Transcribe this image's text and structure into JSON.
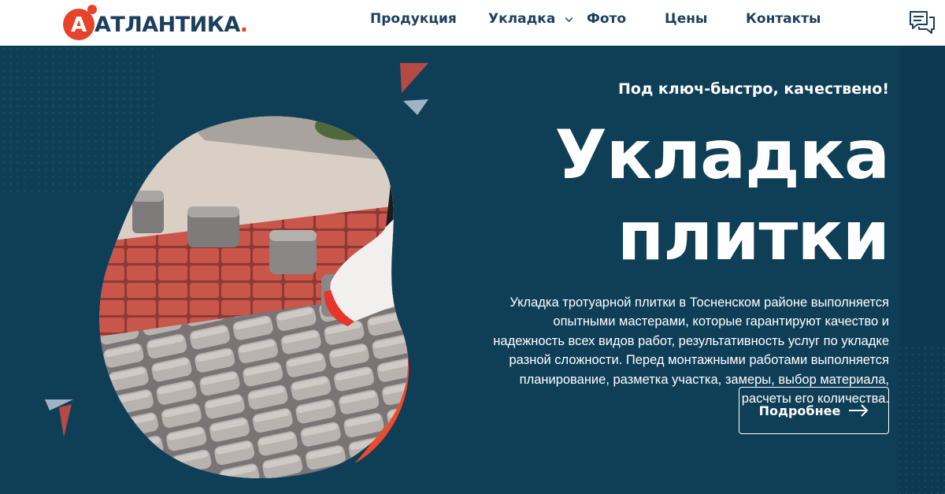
{
  "brand": {
    "mark_letter": "А",
    "name": "АТЛАНТИКА",
    "dot": ".",
    "accent_color": "#e8422b",
    "navy_color": "#1c3f5e"
  },
  "nav": {
    "items": [
      {
        "label": "Продукция",
        "has_dropdown": false
      },
      {
        "label": "Укладка",
        "has_dropdown": true
      },
      {
        "label": "Фото",
        "has_dropdown": false
      },
      {
        "label": "Цены",
        "has_dropdown": false
      },
      {
        "label": "Контакты",
        "has_dropdown": false
      }
    ]
  },
  "chat": {
    "icon": "chat-bubbles-icon"
  },
  "hero": {
    "slogan": "Под ключ-быстро, качествено!",
    "title_line1": "Укладка",
    "title_line2": "плитки",
    "description": "Укладка тротуарной плитки в Тосненском районе выполняется опытными мастерами, которые гарантируют качество и надежность всех видов работ, результативность услуг по укладке разной сложности. Перед монтажными работами выполняется планирование, разметка участка, замеры, выбор материала, расчеты его количества.",
    "button_label": "Подробнее",
    "background_color": "#0f3f57",
    "image_subject": "paving-stones-worker-photo"
  }
}
